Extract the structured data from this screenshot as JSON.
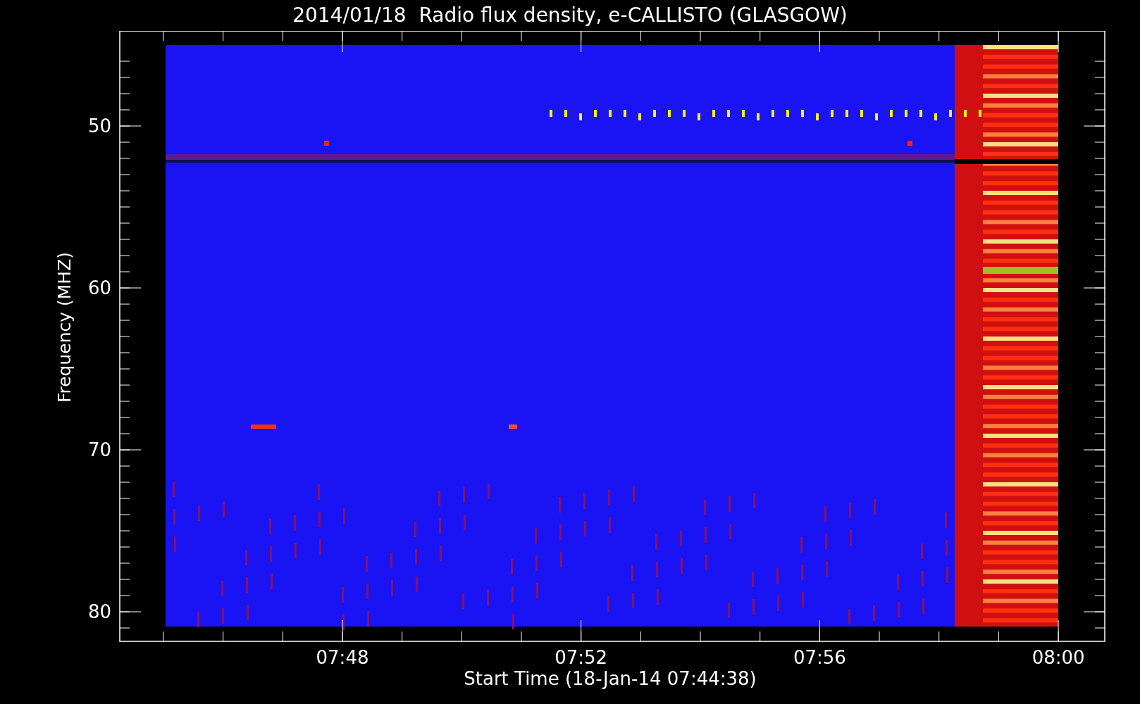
{
  "title": "2014/01/18  Radio flux density, e-CALLISTO (GLASGOW)",
  "plot": {
    "ylabel": "Frequency (MHZ)",
    "xlabel": "Start Time (18-Jan-14 07:44:38)",
    "y_tick_labels": [
      "50",
      "60",
      "70",
      "80"
    ],
    "x_tick_labels": [
      "07:48",
      "07:52",
      "07:56",
      "08:00"
    ]
  }
}
